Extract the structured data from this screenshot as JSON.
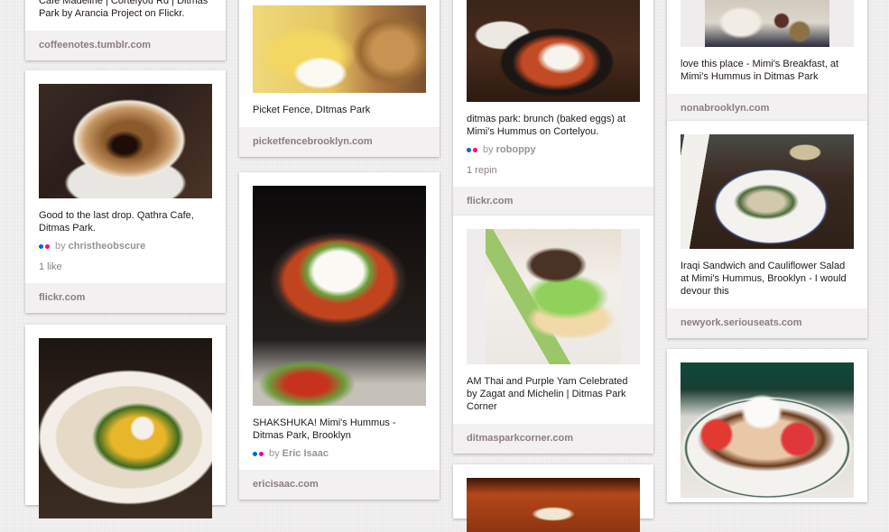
{
  "pins": [
    {
      "id": "c1p1",
      "description": "Cafe Madeline | Cortelyou Rd | Ditmas Park by Arancia Project on Flickr.",
      "source": "coffeenotes.tumblr.com",
      "image": "coffee-cup-image"
    },
    {
      "id": "c1p2",
      "description": "Good to the last drop. Qathra Cafe, Ditmas Park.",
      "pinner_prefix": "by",
      "pinner": "christheobscure",
      "stats": "1 like",
      "source": "flickr.com",
      "image": "empty-coffee-cup-image"
    },
    {
      "id": "c1p3",
      "image": "hummus-chickpeas-image"
    },
    {
      "id": "c2p1",
      "description": "Picket Fence, DItmas Park",
      "source": "picketfencebrooklyn.com",
      "image": "eggs-benedict-image"
    },
    {
      "id": "c2p2",
      "description": "SHAKSHUKA! Mimi's Hummus - Ditmas Park, Brooklyn",
      "pinner_prefix": "by",
      "pinner": "Eric Isaac",
      "source": "ericisaac.com",
      "image": "shakshuka-skillet-image"
    },
    {
      "id": "c3p1",
      "description": "ditmas park: brunch (baked eggs) at Mimi's Hummus on Cortelyou.",
      "pinner_prefix": "by",
      "pinner": "roboppy",
      "stats": "1 repin",
      "source": "flickr.com",
      "image": "baked-eggs-skillet-image"
    },
    {
      "id": "c3p2",
      "description": "AM Thai and Purple Yam Celebrated by Zagat and Michelin | Ditmas Park Corner",
      "source": "ditmasparkcorner.com",
      "image": "burger-image"
    },
    {
      "id": "c3p3",
      "image": "bowl-on-wood-image"
    },
    {
      "id": "c4p1",
      "description": "love this place - Mimi's Breakfast, at Mimi's Hummus in Ditmas Park",
      "source": "nonabrooklyn.com",
      "image": "breakfast-plate-image"
    },
    {
      "id": "c4p2",
      "description": "Iraqi Sandwich and Cauliflower Salad at Mimi's Hummus, Brooklyn - I would devour this",
      "source": "newyork.seriouseats.com",
      "image": "iraqi-sandwich-image"
    },
    {
      "id": "c4p3",
      "image": "toast-poached-egg-image"
    }
  ],
  "colors": {
    "flickr_blue": "#0063dc",
    "flickr_pink": "#ff0084",
    "background": "#efeded",
    "footer": "#f2f0f0"
  }
}
